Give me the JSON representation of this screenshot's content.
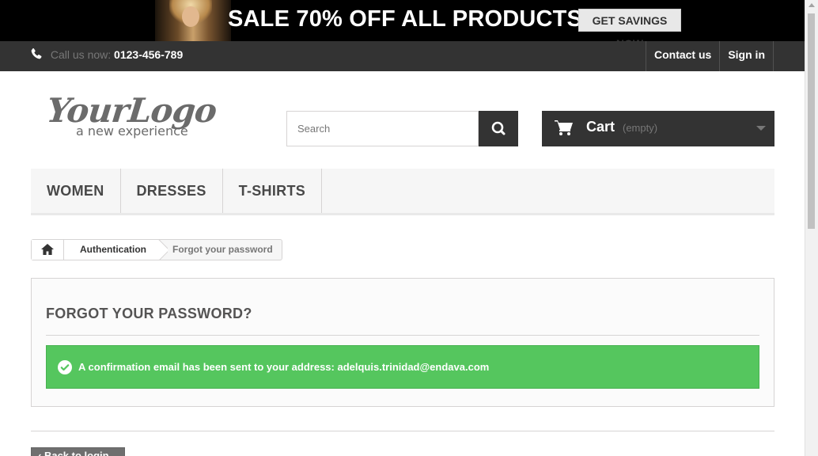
{
  "promo": {
    "headline": "SALE 70% OFF ALL PRODUCTS",
    "button_label": "GET SAVINGS NOW"
  },
  "topbar": {
    "call_label": "Call us now:",
    "phone": "0123-456-789",
    "contact_label": "Contact us",
    "signin_label": "Sign in"
  },
  "logo": {
    "main_text": "YourLogo",
    "tagline": "a new experience"
  },
  "search": {
    "placeholder": "Search",
    "value": "",
    "icon": "search-icon"
  },
  "cart": {
    "label": "Cart",
    "state": "(empty)",
    "icon": "cart-icon"
  },
  "menu": {
    "items": [
      {
        "label": "WOMEN"
      },
      {
        "label": "DRESSES"
      },
      {
        "label": "T-SHIRTS"
      }
    ]
  },
  "breadcrumb": {
    "home_icon": "home-icon",
    "items": [
      {
        "label": "Authentication"
      },
      {
        "label": "Forgot your password"
      }
    ]
  },
  "main": {
    "title": "FORGOT YOUR PASSWORD?",
    "alert_message": "A confirmation email has been sent to your address: adelquis.trinidad@endava.com",
    "alert_color": "#55c65e",
    "back_label": "Back to login"
  }
}
